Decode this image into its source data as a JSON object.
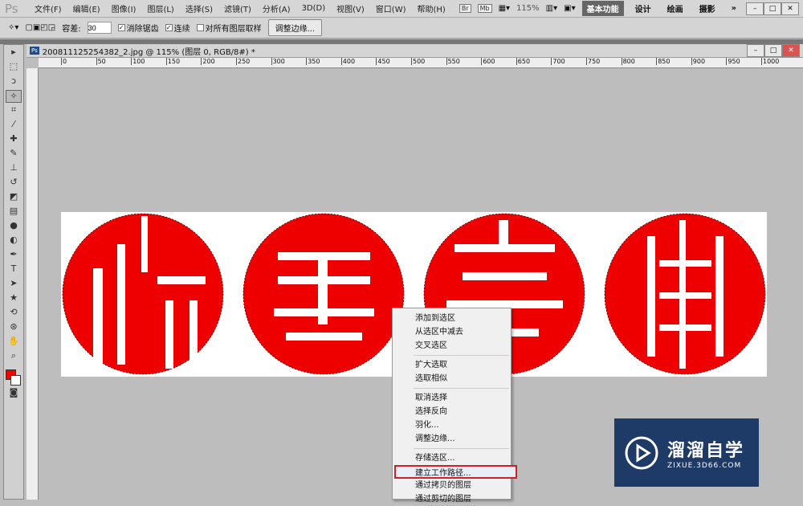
{
  "menubar": {
    "logo": "Ps",
    "items": [
      "文件(F)",
      "编辑(E)",
      "图像(I)",
      "图层(L)",
      "选择(S)",
      "滤镜(T)",
      "分析(A)",
      "3D(D)",
      "视图(V)",
      "窗口(W)",
      "帮助(H)"
    ],
    "br": "Br",
    "mb": "Mb",
    "zoom": "115%",
    "workspaces": [
      "基本功能",
      "设计",
      "绘画",
      "摄影"
    ],
    "more": "»"
  },
  "options": {
    "tolerance_label": "容差:",
    "tolerance": "30",
    "antialias": "消除锯齿",
    "contiguous": "连续",
    "sample_all": "对所有图层取样",
    "refine": "调整边缘..."
  },
  "document": {
    "title": "200811125254382_2.jpg @ 115% (图层 0, RGB/8#) *",
    "ruler": [
      "0",
      "50",
      "100",
      "150",
      "200",
      "250",
      "300",
      "350",
      "400",
      "450",
      "500",
      "550",
      "600",
      "650",
      "700",
      "750",
      "800",
      "850",
      "900",
      "950",
      "1000"
    ]
  },
  "context_menu": {
    "items": [
      "添加到选区",
      "从选区中减去",
      "交叉选区",
      "扩大选取",
      "选取相似",
      "取消选择",
      "选择反向",
      "羽化...",
      "调整边缘...",
      "存储选区...",
      "建立工作路径...",
      "通过拷贝的图层",
      "通过剪切的图层"
    ]
  },
  "watermark": {
    "name": "溜溜自学",
    "url": "ZIXUE.3D66.COM"
  },
  "colors": {
    "seal": "#ee0000",
    "highlight": "#d42020"
  }
}
